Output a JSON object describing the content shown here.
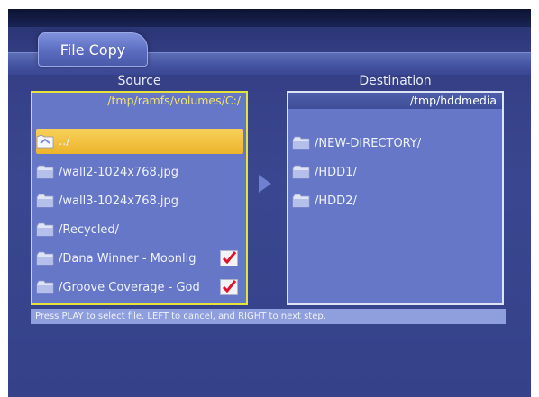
{
  "window": {
    "tab_title": "File Copy"
  },
  "source": {
    "heading": "Source",
    "path": "/tmp/ramfs/volumes/C:/",
    "items": [
      {
        "name": "../",
        "icon": "folder-up-icon",
        "selected": true,
        "checked": false
      },
      {
        "name": "/wall2-1024x768.jpg",
        "icon": "folder-icon",
        "selected": false,
        "checked": false
      },
      {
        "name": "/wall3-1024x768.jpg",
        "icon": "folder-icon",
        "selected": false,
        "checked": false
      },
      {
        "name": "/Recycled/",
        "icon": "folder-icon",
        "selected": false,
        "checked": false
      },
      {
        "name": "/Dana Winner - Moonlig",
        "icon": "folder-icon",
        "selected": false,
        "checked": true
      },
      {
        "name": "/Groove Coverage - God",
        "icon": "folder-icon",
        "selected": false,
        "checked": true
      }
    ]
  },
  "destination": {
    "heading": "Destination",
    "path": "/tmp/hddmedia",
    "items": [
      {
        "name": "/NEW-DIRECTORY/",
        "icon": "folder-icon"
      },
      {
        "name": "/HDD1/",
        "icon": "folder-icon"
      },
      {
        "name": "/HDD2/",
        "icon": "folder-icon"
      }
    ]
  },
  "status": {
    "hint": "Press PLAY to select file. LEFT to cancel, and RIGHT to next step."
  },
  "colors": {
    "panel_background": "#6677c8",
    "selection": "#f0bd37",
    "source_border": "#e4e23c",
    "checkmark": "#e0112c"
  }
}
